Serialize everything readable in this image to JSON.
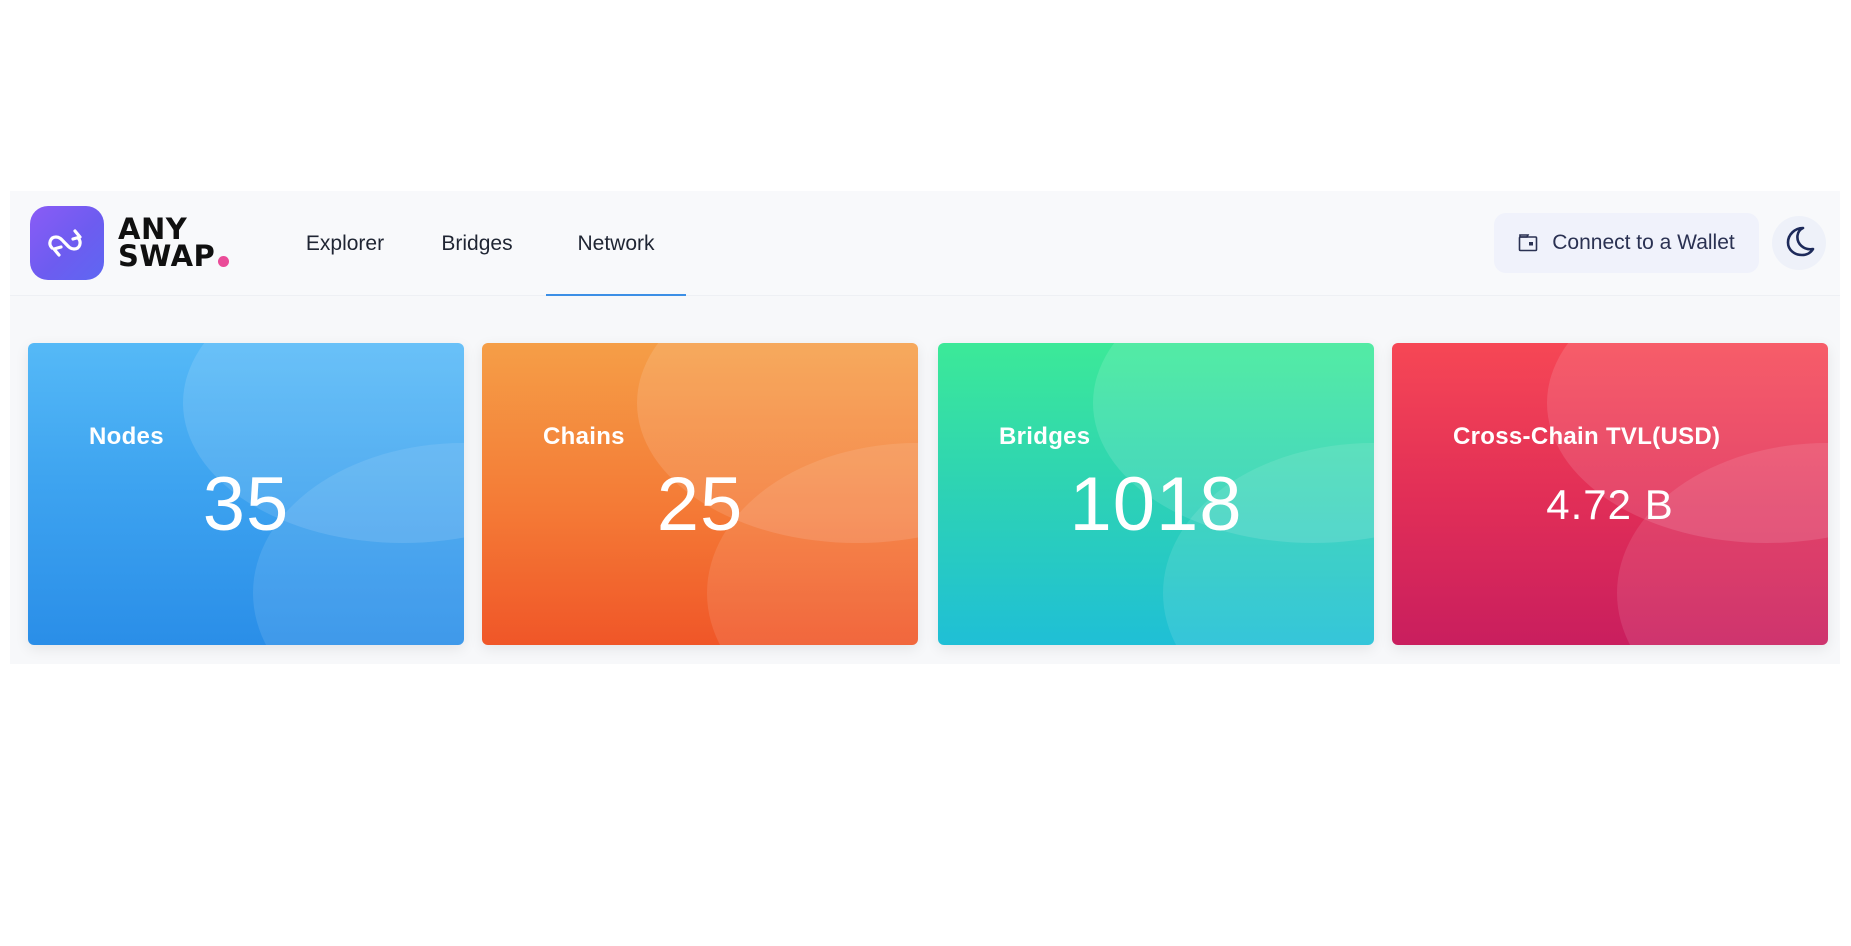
{
  "brand": {
    "line1": "ANY",
    "line2": "SWAP",
    "logo_icon": "swap-arrows-icon",
    "accent_color": "#ea4c98",
    "logo_color": "#6d5cf0"
  },
  "nav": {
    "items": [
      {
        "label": "Explorer",
        "active": false
      },
      {
        "label": "Bridges",
        "active": false
      },
      {
        "label": "Network",
        "active": true
      }
    ],
    "active_color": "#3c8fe6"
  },
  "header_actions": {
    "wallet_label": "Connect to a Wallet",
    "wallet_icon": "wallet-icon",
    "theme_icon": "moon-icon"
  },
  "stats": [
    {
      "label": "Nodes",
      "value": "35",
      "color": "#3ea4f0"
    },
    {
      "label": "Chains",
      "value": "25",
      "color": "#f47a36"
    },
    {
      "label": "Bridges",
      "value": "1018",
      "color": "#2dd2b5"
    },
    {
      "label": "Cross-Chain TVL(USD)",
      "value": "4.72 B",
      "color": "#e22f57"
    }
  ]
}
